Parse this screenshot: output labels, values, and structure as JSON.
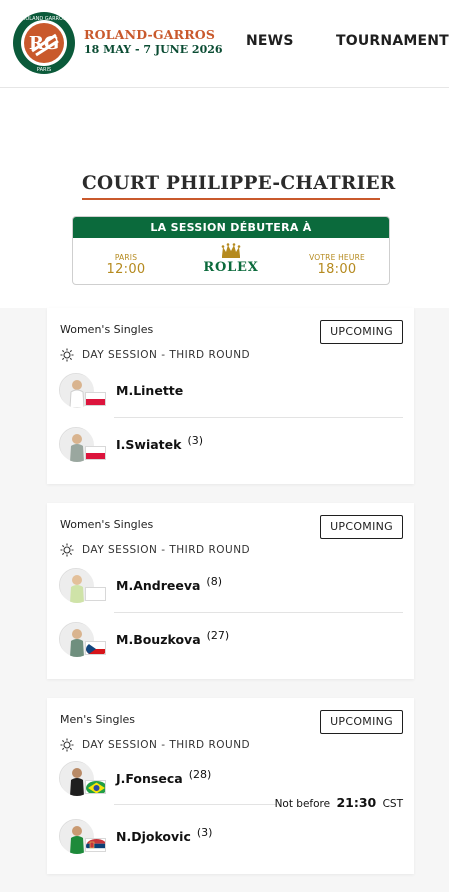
{
  "header": {
    "logo_text": "ROLAND GARROS PARIS",
    "brand_name": "ROLAND-GARROS",
    "brand_dates": "18 MAY - 7 JUNE 2026",
    "nav": [
      "NEWS",
      "TOURNAMENT"
    ]
  },
  "court": {
    "title": "COURT PHILIPPE-CHATRIER",
    "session": {
      "heading": "LA SESSION DÉBUTERA À",
      "left_label": "PARIS",
      "left_time": "12:00",
      "sponsor": "ROLEX",
      "right_label": "VOTRE HEURE",
      "right_time": "18:00"
    }
  },
  "colors": {
    "accent": "#c9592c",
    "green": "#0b6a3c",
    "gold": "#b58a1f"
  },
  "matches": [
    {
      "category": "Women's Singles",
      "status": "UPCOMING",
      "round_icon": "sun-icon",
      "round": "DAY SESSION - THIRD ROUND",
      "players": [
        {
          "name": "M.Linette",
          "seed": "",
          "flag": "poland-flag"
        },
        {
          "name": "I.Swiatek",
          "seed": "(3)",
          "flag": "poland-flag"
        }
      ]
    },
    {
      "category": "Women's Singles",
      "status": "UPCOMING",
      "round_icon": "sun-icon",
      "round": "DAY SESSION - THIRD ROUND",
      "players": [
        {
          "name": "M.Andreeva",
          "seed": "(8)",
          "flag": "blank-flag"
        },
        {
          "name": "M.Bouzkova",
          "seed": "(27)",
          "flag": "czech-flag"
        }
      ]
    },
    {
      "category": "Men's Singles",
      "status": "UPCOMING",
      "round_icon": "sun-icon",
      "round": "DAY SESSION - THIRD ROUND",
      "players": [
        {
          "name": "J.Fonseca",
          "seed": "(28)",
          "flag": "brazil-flag"
        },
        {
          "name": "N.Djokovic",
          "seed": "(3)",
          "flag": "serbia-flag"
        }
      ],
      "not_before": {
        "label": "Not before",
        "time": "21:30",
        "tz": "CST"
      }
    }
  ]
}
